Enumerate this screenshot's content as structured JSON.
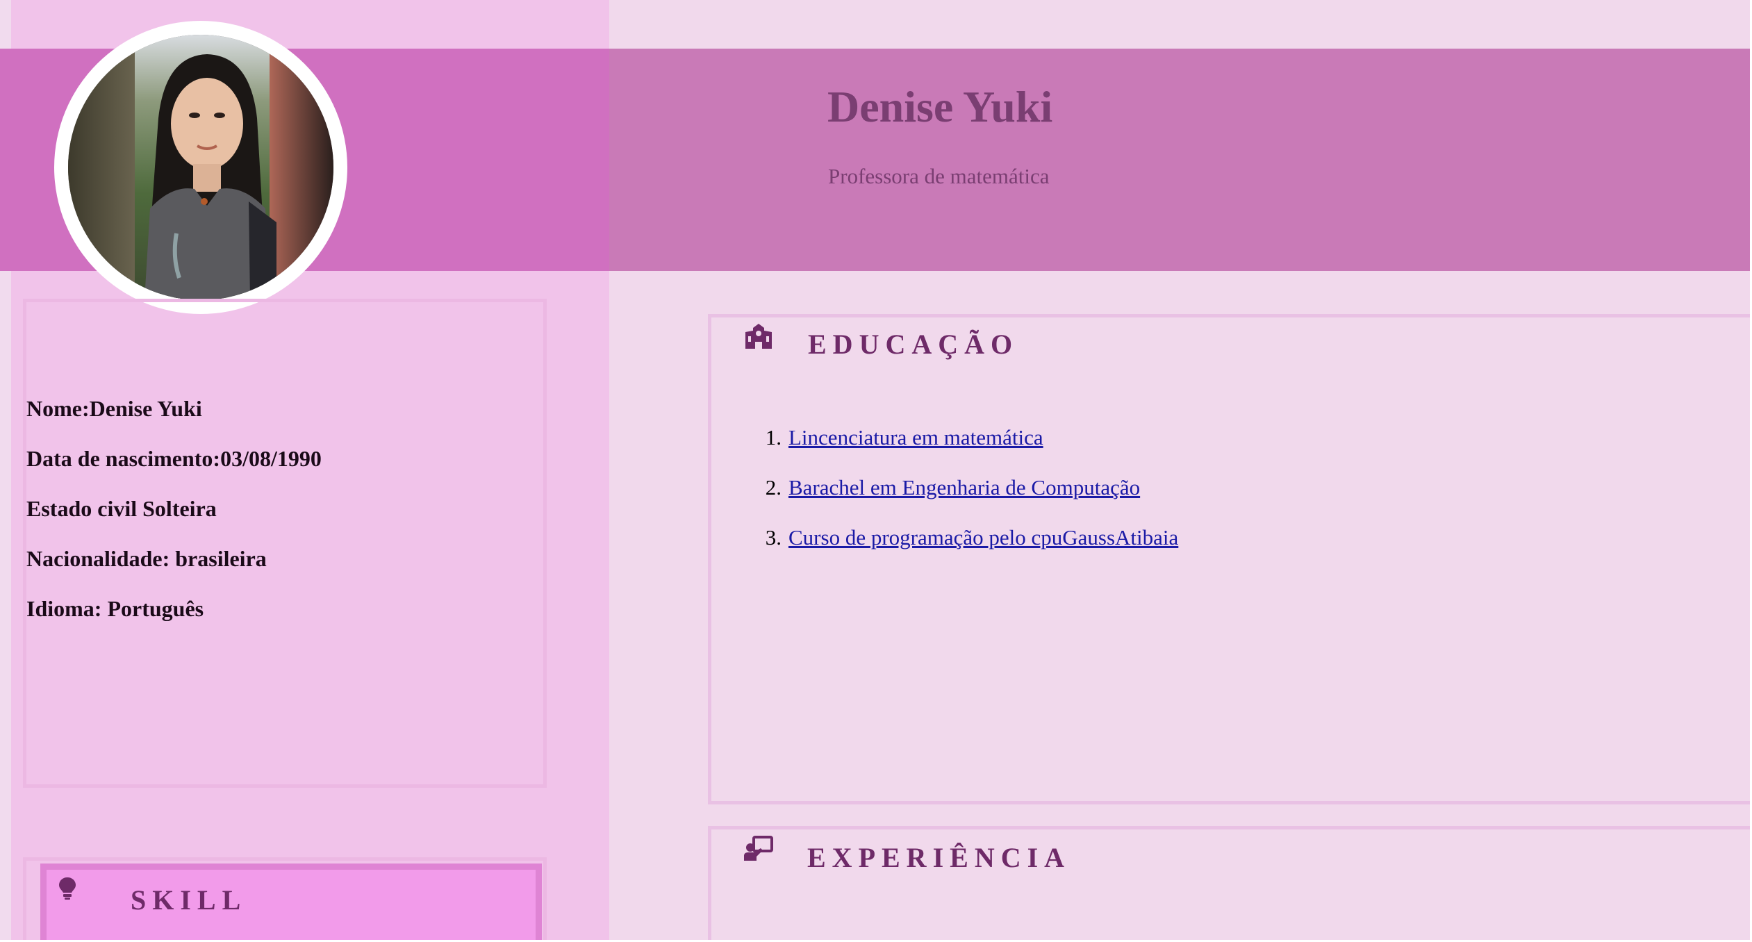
{
  "header": {
    "name": "Denise Yuki",
    "title": "Professora de matemática"
  },
  "profile": {
    "lines": [
      "Nome:Denise Yuki",
      "Data de nascimento:03/08/1990",
      "Estado civil Solteira",
      "Nacionalidade: brasileira",
      "Idioma: Português"
    ]
  },
  "skill": {
    "heading": "SKILL",
    "icon": "lightbulb-icon"
  },
  "education": {
    "heading": "EDUCAÇÃO",
    "icon": "school-icon",
    "items": [
      {
        "number": "1.",
        "label": "Lincenciatura em matemática"
      },
      {
        "number": "2.",
        "label": "Barachel em Engenharia de Computação"
      },
      {
        "number": "3.",
        "label": "Curso de programação pelo cpuGaussAtibaia"
      }
    ]
  },
  "experience": {
    "heading": "EXPERIÊNCIA",
    "icon": "teacher-board-icon"
  },
  "colors": {
    "page_background": "#f1d9ec",
    "sidebar_background": "#f1c3ea",
    "header_band": "#c97ab7",
    "heading_text": "#6e2a68",
    "link": "#1a1aa6"
  }
}
